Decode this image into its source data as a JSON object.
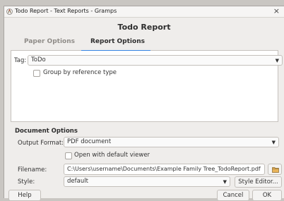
{
  "window": {
    "title": "Todo Report - Text Reports - Gramps",
    "close": "×"
  },
  "header": {
    "title": "Todo Report"
  },
  "tabs": [
    {
      "label": "Paper Options",
      "active": false
    },
    {
      "label": "Report Options",
      "active": true
    }
  ],
  "report_options": {
    "tag_label": "Tag:",
    "tag_value": "ToDo",
    "group_by_label": "Group by reference type",
    "group_by_checked": false
  },
  "document_options": {
    "title": "Document Options",
    "output_format_label": "Output Format:",
    "output_format_value": "PDF document",
    "open_default_label": "Open with default viewer",
    "open_default_checked": false,
    "filename_label": "Filename:",
    "filename_value": "C:\\Users\\username\\Documents\\Example Family Tree_TodoReport.pdf",
    "style_label": "Style:",
    "style_value": "default",
    "style_editor_label": "Style Editor..."
  },
  "buttons": {
    "help": "Help",
    "cancel": "Cancel",
    "ok": "OK"
  },
  "icons": {
    "app": "gramps-app-icon",
    "folder": "folder-icon",
    "dropdown": "dropdown-arrow-icon"
  },
  "colors": {
    "accent": "#3584e4",
    "tab_inactive": "#8f8c88"
  }
}
